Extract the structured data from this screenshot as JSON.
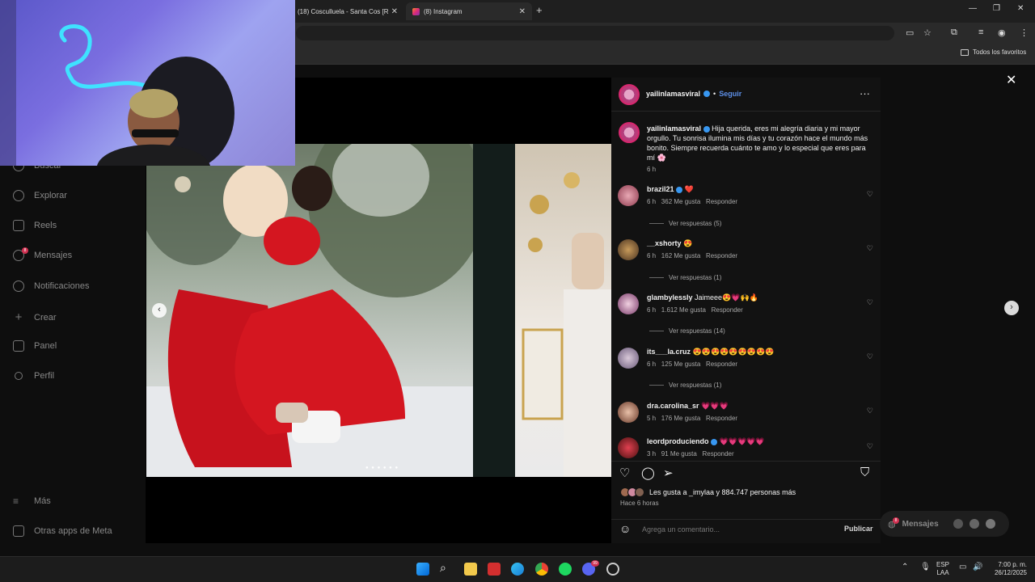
{
  "browser": {
    "tabs": [
      {
        "title": "(18) Cosculluela - Santa Cos [R"
      },
      {
        "title": "(8) Instagram"
      }
    ],
    "bookmarks_label": "Todos los favoritos"
  },
  "sidebar": {
    "items": [
      {
        "label": "Buscar",
        "icon": "search-icon"
      },
      {
        "label": "Explorar",
        "icon": "compass-icon"
      },
      {
        "label": "Reels",
        "icon": "reels-icon"
      },
      {
        "label": "Mensajes",
        "icon": "messenger-icon",
        "badge": "8"
      },
      {
        "label": "Notificaciones",
        "icon": "heart-icon"
      },
      {
        "label": "Crear",
        "icon": "plus-icon"
      },
      {
        "label": "Panel",
        "icon": "chart-icon"
      },
      {
        "label": "Perfil",
        "icon": "profile-icon"
      }
    ],
    "footer": [
      {
        "label": "Más",
        "icon": "menu-icon"
      },
      {
        "label": "Otras apps de Meta",
        "icon": "meta-icon"
      }
    ]
  },
  "post": {
    "username": "yailinlamasviral",
    "follow_label": "Seguir",
    "caption": "Hija querida, eres mi alegría diaria y mi mayor orgullo. Tu sonrisa ilumina mis días y tu corazón hace el mundo más bonito. Siempre recuerda cuánto te amo y lo especial que eres para mí 🌸",
    "caption_time": "6 h",
    "likes_text": "Les gusta a _imylaa y 884.747 personas más",
    "posted_ago": "Hace 6 horas",
    "comment_placeholder": "Agrega un comentario...",
    "publish_label": "Publicar",
    "reply_label": "Responder"
  },
  "comments": [
    {
      "user": "brazil21",
      "text": "❤️",
      "time": "6 h",
      "likes": "362 Me gusta",
      "replies": "Ver respuestas (5)",
      "verified": true
    },
    {
      "user": "__xshorty",
      "text": "😍",
      "time": "6 h",
      "likes": "162 Me gusta",
      "replies": "Ver respuestas (1)",
      "verified": false
    },
    {
      "user": "glambylessly",
      "text": "Jaimeee😍💗🙌🔥",
      "time": "6 h",
      "likes": "1.612 Me gusta",
      "replies": "Ver respuestas (14)",
      "verified": false
    },
    {
      "user": "its___la.cruz",
      "text": "😍😍😍😍😍😍😍😍😍",
      "time": "6 h",
      "likes": "125 Me gusta",
      "replies": "Ver respuestas (1)",
      "verified": false
    },
    {
      "user": "dra.carolina_sr",
      "text": "💗💗💗",
      "time": "5 h",
      "likes": "176 Me gusta",
      "replies": "",
      "verified": false
    },
    {
      "user": "leordproduciendo",
      "text": "💗💗💗💗💗",
      "time": "3 h",
      "likes": "91 Me gusta",
      "replies": "",
      "verified": true
    }
  ],
  "messages_pill": {
    "label": "Mensajes",
    "badge": "8"
  },
  "taskbar": {
    "lang": "ESP",
    "layout": "LAA",
    "time": "7:00 p. m.",
    "date": "26/12/2025",
    "discord_badge": "99"
  },
  "colors": {
    "accent_blue": "#5d8fe8",
    "badge_red": "#d03050",
    "verified": "#3897f0"
  }
}
